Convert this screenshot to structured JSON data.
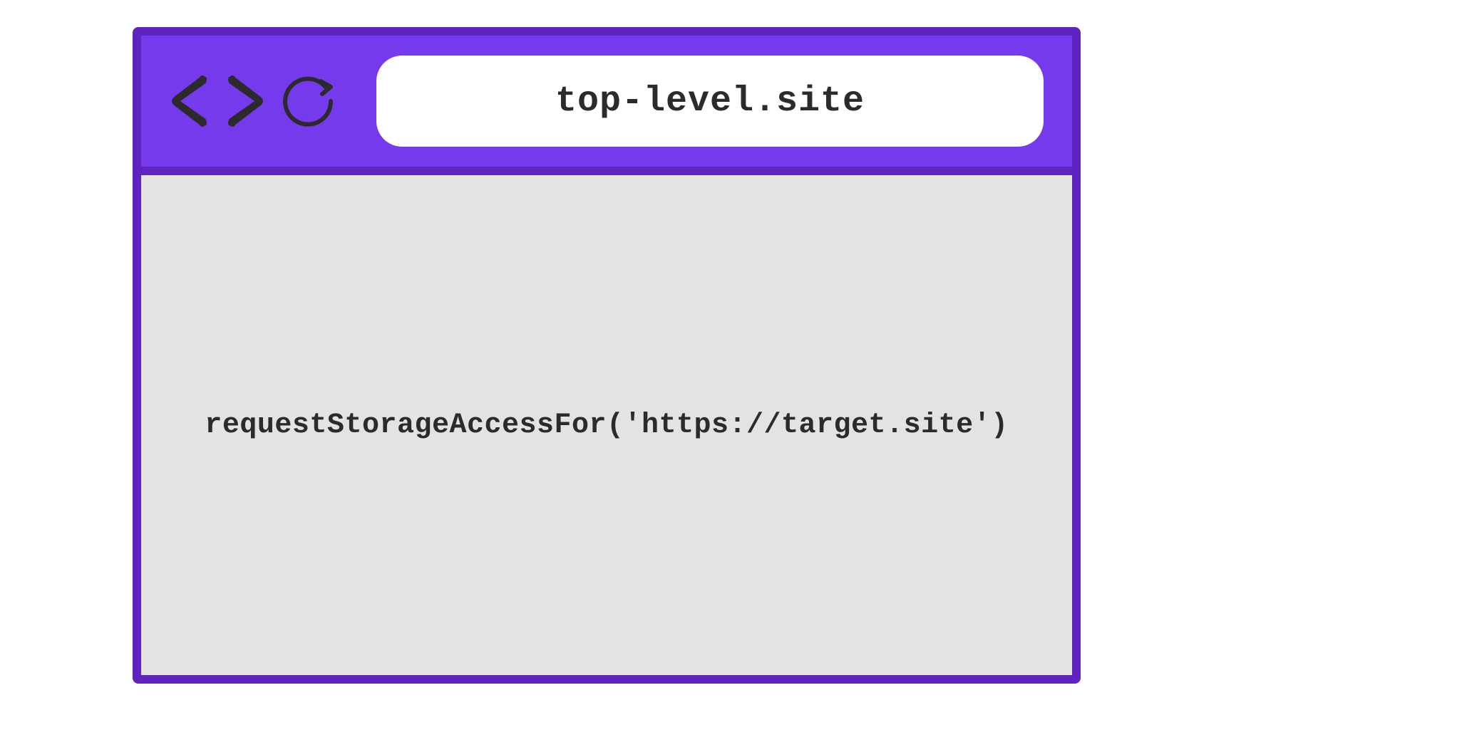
{
  "browser": {
    "address": "top-level.site"
  },
  "viewport": {
    "code": "requestStorageAccessFor('https://target.site')"
  },
  "colors": {
    "toolbar_bg": "#753aec",
    "border": "#5e23c1",
    "viewport_bg": "#e3e3e3",
    "address_bg": "#ffffff",
    "text": "#2b2b2b"
  }
}
